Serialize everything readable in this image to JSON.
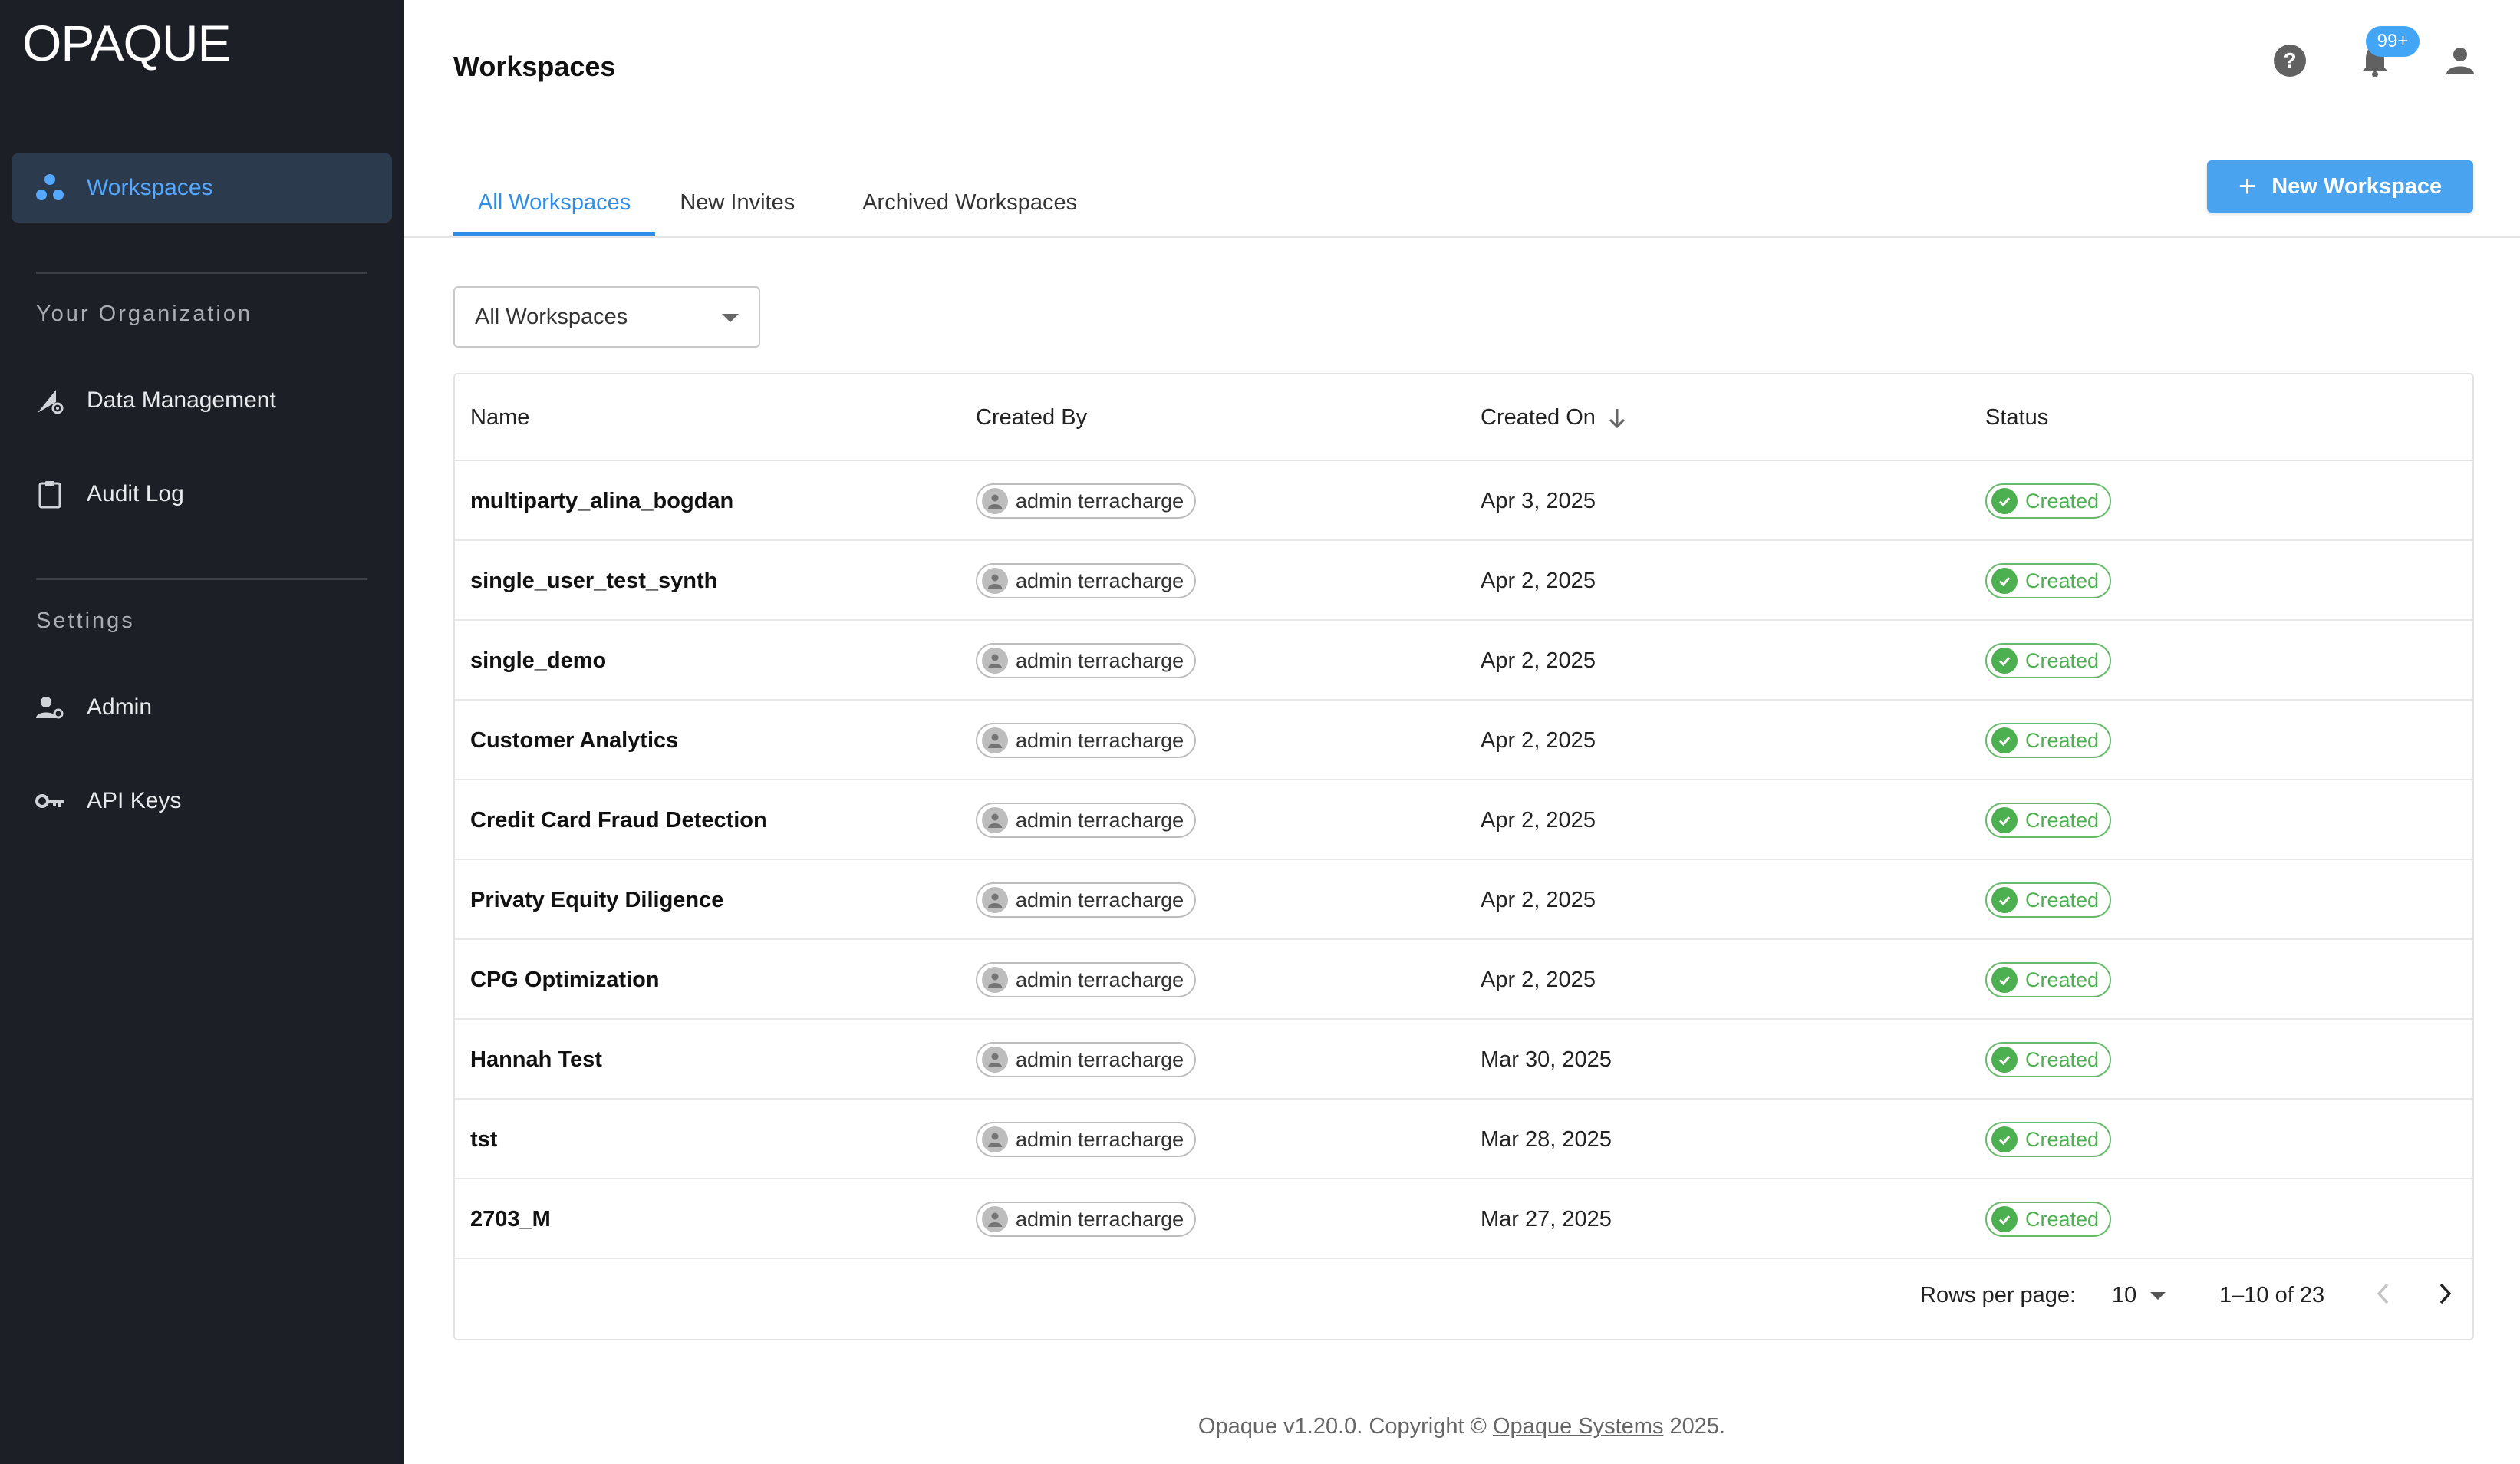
{
  "brand": {
    "logo": "OPAQUE"
  },
  "sidebar": {
    "items": [
      {
        "label": "Workspaces",
        "icon": "workspaces-icon",
        "active": true
      },
      {
        "label": "Data Management",
        "icon": "data-management-icon"
      },
      {
        "label": "Audit Log",
        "icon": "clipboard-icon"
      },
      {
        "label": "Admin",
        "icon": "admin-icon"
      },
      {
        "label": "API Keys",
        "icon": "key-icon"
      }
    ],
    "sections": {
      "organization": "Your Organization",
      "settings": "Settings"
    }
  },
  "header": {
    "title": "Workspaces",
    "notification_badge": "99+",
    "icons": [
      "help-icon",
      "bell-icon",
      "account-icon"
    ]
  },
  "tabs": [
    {
      "label": "All Workspaces",
      "active": true
    },
    {
      "label": "New Invites"
    },
    {
      "label": "Archived Workspaces"
    }
  ],
  "actions": {
    "new_workspace": "New Workspace"
  },
  "filter": {
    "selected": "All Workspaces"
  },
  "table": {
    "columns": {
      "name": "Name",
      "created_by": "Created By",
      "created_on": "Created On",
      "status": "Status"
    },
    "rows": [
      {
        "name": "multiparty_alina_bogdan",
        "created_by": "admin terracharge",
        "created_on": "Apr 3, 2025",
        "status": "Created"
      },
      {
        "name": "single_user_test_synth",
        "created_by": "admin terracharge",
        "created_on": "Apr 2, 2025",
        "status": "Created"
      },
      {
        "name": "single_demo",
        "created_by": "admin terracharge",
        "created_on": "Apr 2, 2025",
        "status": "Created"
      },
      {
        "name": "Customer Analytics",
        "created_by": "admin terracharge",
        "created_on": "Apr 2, 2025",
        "status": "Created"
      },
      {
        "name": "Credit Card Fraud Detection",
        "created_by": "admin terracharge",
        "created_on": "Apr 2, 2025",
        "status": "Created"
      },
      {
        "name": "Privaty Equity Diligence",
        "created_by": "admin terracharge",
        "created_on": "Apr 2, 2025",
        "status": "Created"
      },
      {
        "name": "CPG Optimization",
        "created_by": "admin terracharge",
        "created_on": "Apr 2, 2025",
        "status": "Created"
      },
      {
        "name": "Hannah Test",
        "created_by": "admin terracharge",
        "created_on": "Mar 30, 2025",
        "status": "Created"
      },
      {
        "name": "tst",
        "created_by": "admin terracharge",
        "created_on": "Mar 28, 2025",
        "status": "Created"
      },
      {
        "name": "2703_M",
        "created_by": "admin terracharge",
        "created_on": "Mar 27, 2025",
        "status": "Created"
      }
    ]
  },
  "pagination": {
    "rows_per_page_label": "Rows per page:",
    "rows_per_page": "10",
    "range": "1–10 of 23"
  },
  "footer": {
    "prefix": "Opaque v1.20.0. Copyright ©",
    "link": "Opaque Systems",
    "suffix": "2025."
  },
  "colors": {
    "sidebar_bg": "#1c1f25",
    "accent": "#2e8de8",
    "button": "#4aa3ef",
    "status_green": "#4caf50"
  }
}
